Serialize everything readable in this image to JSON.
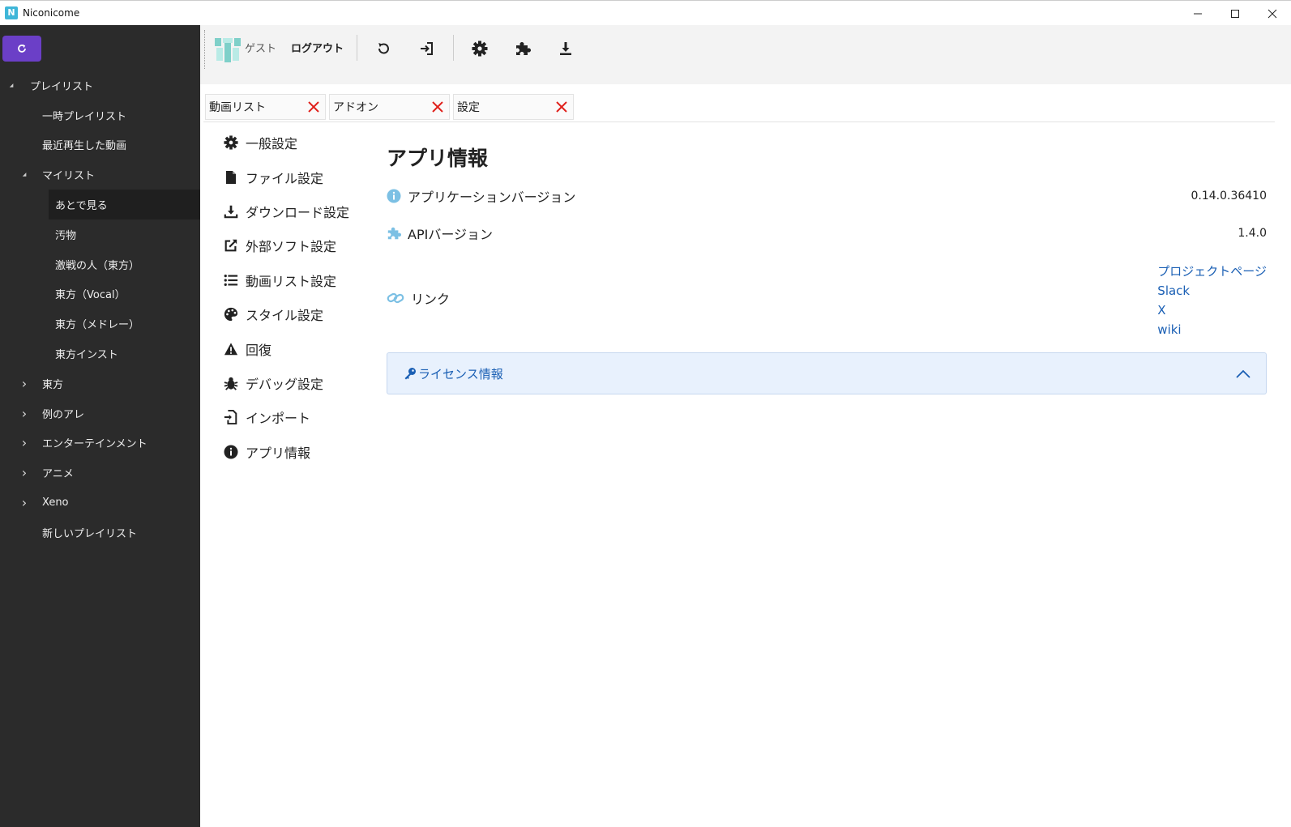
{
  "window": {
    "title": "Niconicome",
    "logo_letter": "N"
  },
  "toolbar": {
    "guest_label": "ゲスト",
    "logout_label": "ログアウト"
  },
  "sidebar": {
    "items": [
      {
        "label": "プレイリスト",
        "level": 0,
        "chevron": "expanded"
      },
      {
        "label": "一時プレイリスト",
        "level": 1,
        "chevron": "none"
      },
      {
        "label": "最近再生した動画",
        "level": 1,
        "chevron": "none"
      },
      {
        "label": "マイリスト",
        "level": 1,
        "chevron": "expanded"
      },
      {
        "label": "あとで見る",
        "level": 2,
        "chevron": "none",
        "selected": true
      },
      {
        "label": "汚物",
        "level": 2,
        "chevron": "none"
      },
      {
        "label": "激戦の人（東方）",
        "level": 2,
        "chevron": "none"
      },
      {
        "label": "東方（Vocal）",
        "level": 2,
        "chevron": "none"
      },
      {
        "label": "東方（メドレー）",
        "level": 2,
        "chevron": "none"
      },
      {
        "label": "東方インスト",
        "level": 2,
        "chevron": "none"
      },
      {
        "label": "東方",
        "level": 1,
        "chevron": "collapsed"
      },
      {
        "label": "例のアレ",
        "level": 1,
        "chevron": "collapsed"
      },
      {
        "label": "エンターテインメント",
        "level": 1,
        "chevron": "collapsed"
      },
      {
        "label": "アニメ",
        "level": 1,
        "chevron": "collapsed"
      },
      {
        "label": "Xeno",
        "level": 1,
        "chevron": "collapsed"
      },
      {
        "label": "新しいプレイリスト",
        "level": 1,
        "chevron": "none"
      }
    ]
  },
  "tabs": [
    {
      "label": "動画リスト"
    },
    {
      "label": "アドオン"
    },
    {
      "label": "設定"
    }
  ],
  "settings_menu": [
    {
      "label": "一般設定",
      "icon": "gear-icon"
    },
    {
      "label": "ファイル設定",
      "icon": "file-icon"
    },
    {
      "label": "ダウンロード設定",
      "icon": "download-icon"
    },
    {
      "label": "外部ソフト設定",
      "icon": "external-link-icon"
    },
    {
      "label": "動画リスト設定",
      "icon": "list-icon"
    },
    {
      "label": "スタイル設定",
      "icon": "palette-icon"
    },
    {
      "label": "回復",
      "icon": "warning-icon"
    },
    {
      "label": "デバッグ設定",
      "icon": "bug-icon"
    },
    {
      "label": "インポート",
      "icon": "import-icon"
    },
    {
      "label": "アプリ情報",
      "icon": "info-icon"
    }
  ],
  "app_info": {
    "title": "アプリ情報",
    "app_version_label": "アプリケーションバージョン",
    "app_version": "0.14.0.36410",
    "api_version_label": "APIバージョン",
    "api_version": "1.4.0",
    "links_label": "リンク",
    "links": [
      "プロジェクトページ",
      "Slack",
      "X",
      "wiki"
    ],
    "license_label": "ライセンス情報"
  },
  "colors": {
    "accent": "#6b3fc7",
    "sidebar_bg": "#2b2b2b",
    "link": "#1a5fb4",
    "close_x": "#e0201b"
  }
}
